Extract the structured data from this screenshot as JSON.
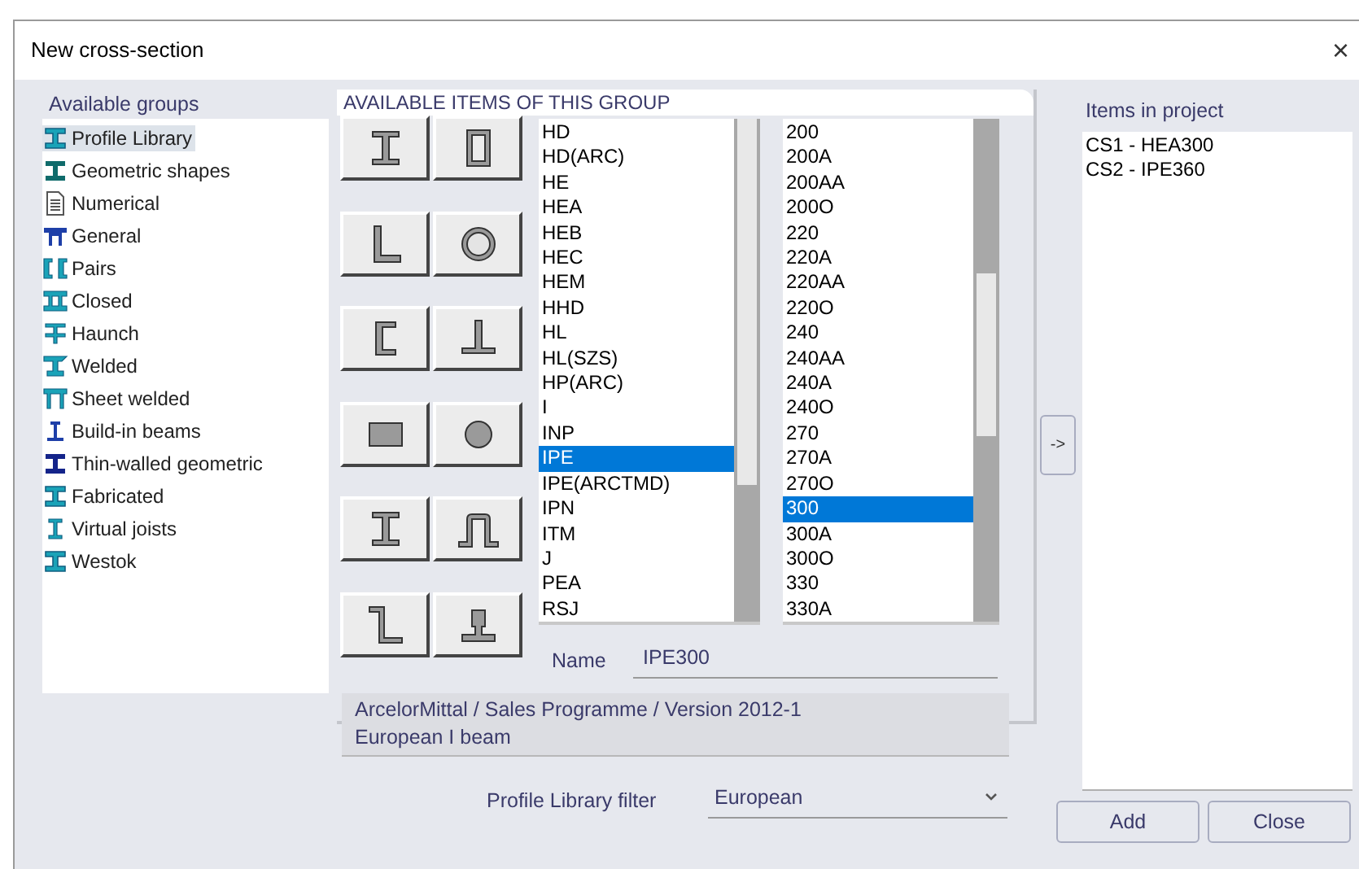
{
  "window": {
    "title": "New cross-section",
    "close": "×"
  },
  "groups": {
    "label": "Available groups",
    "items": [
      {
        "label": "Profile Library",
        "kind": "ibeam",
        "selected": true
      },
      {
        "label": "Geometric shapes",
        "kind": "solid",
        "selected": false
      },
      {
        "label": "Numerical",
        "kind": "doc",
        "selected": false
      },
      {
        "label": "General",
        "kind": "general",
        "selected": false
      },
      {
        "label": "Pairs",
        "kind": "pairs",
        "selected": false
      },
      {
        "label": "Closed",
        "kind": "closed",
        "selected": false
      },
      {
        "label": "Haunch",
        "kind": "haunch",
        "selected": false
      },
      {
        "label": "Welded",
        "kind": "welded",
        "selected": false
      },
      {
        "label": "Sheet welded",
        "kind": "sheet",
        "selected": false
      },
      {
        "label": "Build-in beams",
        "kind": "buildin",
        "selected": false
      },
      {
        "label": "Thin-walled geometric",
        "kind": "thin",
        "selected": false
      },
      {
        "label": "Fabricated",
        "kind": "ibeam",
        "selected": false
      },
      {
        "label": "Virtual joists",
        "kind": "joist",
        "selected": false
      },
      {
        "label": "Westok",
        "kind": "ibeam",
        "selected": false
      }
    ]
  },
  "items_group": {
    "label": "AVAILABLE ITEMS OF THIS GROUP",
    "shape_buttons": [
      {
        "kind": "ibeam"
      },
      {
        "kind": "rhs"
      },
      {
        "kind": "angle"
      },
      {
        "kind": "chs"
      },
      {
        "kind": "channel"
      },
      {
        "kind": "tee"
      },
      {
        "kind": "rect"
      },
      {
        "kind": "circle"
      },
      {
        "kind": "ibeam2"
      },
      {
        "kind": "omega"
      },
      {
        "kind": "zed"
      },
      {
        "kind": "rail"
      }
    ],
    "types": [
      {
        "label": "HD",
        "selected": false
      },
      {
        "label": "HD(ARC)",
        "selected": false
      },
      {
        "label": "HE",
        "selected": false
      },
      {
        "label": "HEA",
        "selected": false
      },
      {
        "label": "HEB",
        "selected": false
      },
      {
        "label": "HEC",
        "selected": false
      },
      {
        "label": "HEM",
        "selected": false
      },
      {
        "label": "HHD",
        "selected": false
      },
      {
        "label": "HL",
        "selected": false
      },
      {
        "label": "HL(SZS)",
        "selected": false
      },
      {
        "label": "HP(ARC)",
        "selected": false
      },
      {
        "label": "I",
        "selected": false
      },
      {
        "label": "INP",
        "selected": false
      },
      {
        "label": "IPE",
        "selected": true
      },
      {
        "label": "IPE(ARCTMD)",
        "selected": false
      },
      {
        "label": "IPN",
        "selected": false
      },
      {
        "label": "ITM",
        "selected": false
      },
      {
        "label": "J",
        "selected": false
      },
      {
        "label": "PEA",
        "selected": false
      },
      {
        "label": "RSJ",
        "selected": false
      }
    ],
    "sizes": [
      {
        "label": "200",
        "selected": false
      },
      {
        "label": "200A",
        "selected": false
      },
      {
        "label": "200AA",
        "selected": false
      },
      {
        "label": "200O",
        "selected": false
      },
      {
        "label": "220",
        "selected": false
      },
      {
        "label": "220A",
        "selected": false
      },
      {
        "label": "220AA",
        "selected": false
      },
      {
        "label": "220O",
        "selected": false
      },
      {
        "label": "240",
        "selected": false
      },
      {
        "label": "240AA",
        "selected": false
      },
      {
        "label": "240A",
        "selected": false
      },
      {
        "label": "240O",
        "selected": false
      },
      {
        "label": "270",
        "selected": false
      },
      {
        "label": "270A",
        "selected": false
      },
      {
        "label": "270O",
        "selected": false
      },
      {
        "label": "300",
        "selected": true
      },
      {
        "label": "300A",
        "selected": false
      },
      {
        "label": "300O",
        "selected": false
      },
      {
        "label": "330",
        "selected": false
      },
      {
        "label": "330A",
        "selected": false
      }
    ],
    "name_label": "Name",
    "name_value": "IPE300",
    "description": [
      "ArcelorMittal / Sales Programme / Version 2012-1",
      "European I beam"
    ]
  },
  "transfer_button": "->",
  "project": {
    "label": "Items in project",
    "items": [
      "CS1 - HEA300",
      "CS2 - IPE360"
    ]
  },
  "filter": {
    "label": "Profile Library filter",
    "value": "European"
  },
  "buttons": [
    "Add",
    "Close"
  ]
}
